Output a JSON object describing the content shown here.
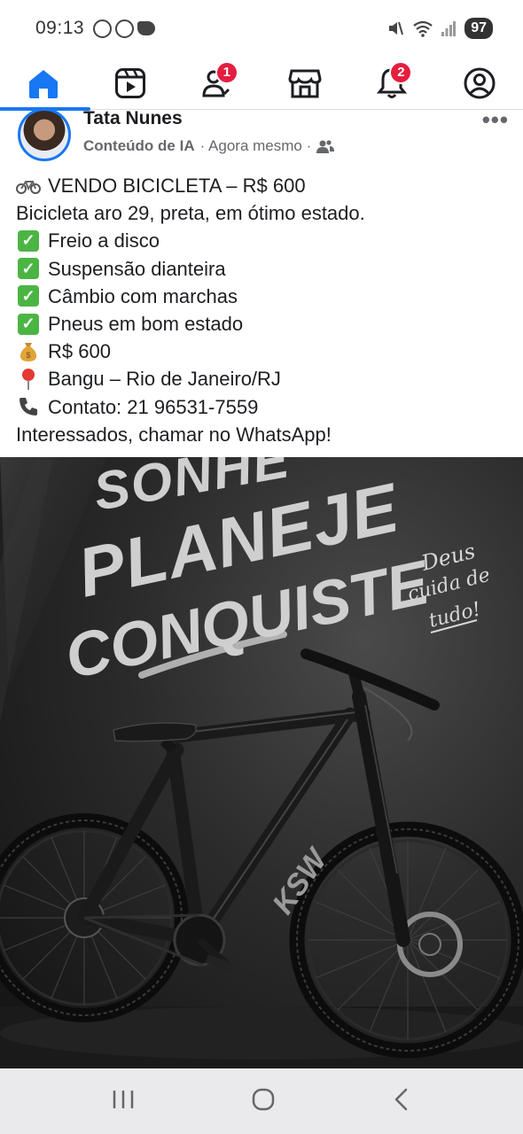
{
  "status_bar": {
    "time": "09:13",
    "battery": "97"
  },
  "nav": {
    "items": [
      {
        "name": "home",
        "badge": ""
      },
      {
        "name": "video",
        "badge": ""
      },
      {
        "name": "friends",
        "badge": "1"
      },
      {
        "name": "marketplace",
        "badge": ""
      },
      {
        "name": "notifications",
        "badge": "2"
      },
      {
        "name": "profile",
        "badge": ""
      }
    ],
    "accent": "#1877f2",
    "badge_color": "#e41e3f"
  },
  "post": {
    "author": "Tata Nunes",
    "label": "Conteúdo de IA",
    "time": "· Agora mesmo ·",
    "more": "•••",
    "lines": [
      {
        "icon": "bicycle-icon",
        "text": "VENDO BICICLETA – R$ 600"
      },
      {
        "icon": "",
        "text": "Bicicleta aro 29, preta, em ótimo estado."
      },
      {
        "icon": "check-icon",
        "text": "Freio a disco"
      },
      {
        "icon": "check-icon",
        "text": "Suspensão dianteira"
      },
      {
        "icon": "check-icon",
        "text": "Câmbio com marchas"
      },
      {
        "icon": "check-icon",
        "text": "Pneus em bom estado"
      },
      {
        "icon": "money-bag-icon",
        "text": "R$ 600"
      },
      {
        "icon": "pin-icon",
        "text": "Bangu – Rio de Janeiro/RJ"
      },
      {
        "icon": "phone-icon",
        "text": "Contato: 21 96531-7559"
      },
      {
        "icon": "",
        "text": "Interessados, chamar no WhatsApp!"
      }
    ]
  },
  "image": {
    "headline": [
      "SONHE",
      "PLANEJE",
      "CONQUISTE"
    ],
    "script_text": [
      "Deus",
      "cuida de",
      "tudo!"
    ],
    "frame_brand": "KSW"
  }
}
